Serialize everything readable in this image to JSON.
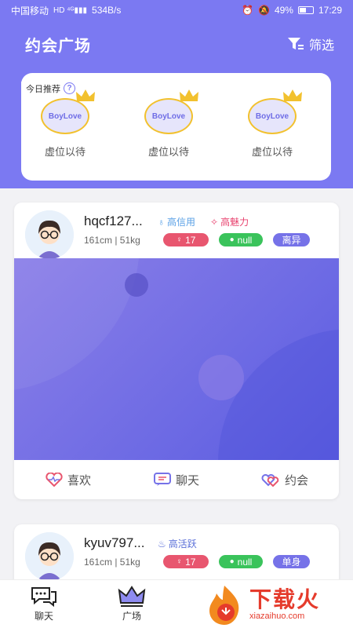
{
  "status_bar": {
    "carrier": "中国移动",
    "speed": "534B/s",
    "battery": "49%",
    "time": "17:29"
  },
  "header": {
    "title": "约会广场",
    "filter_label": "筛选"
  },
  "recommend": {
    "badge": "今日推荐",
    "items": [
      {
        "logo": "BoyLove",
        "label": "虚位以待"
      },
      {
        "logo": "BoyLove",
        "label": "虚位以待"
      },
      {
        "logo": "BoyLove",
        "label": "虚位以待"
      }
    ]
  },
  "profiles": [
    {
      "name": "hqcf127...",
      "tags": [
        {
          "icon": "bulb-icon",
          "label": "高信用",
          "color": "#5aa0e6"
        },
        {
          "icon": "sparkle-icon",
          "label": "高魅力",
          "color": "#e8436f"
        }
      ],
      "info": "161cm | 51kg",
      "age": "17",
      "location": "null",
      "status": "离异",
      "actions": {
        "like": "喜欢",
        "chat": "聊天",
        "date": "约会"
      }
    },
    {
      "name": "kyuv797...",
      "tags": [
        {
          "icon": "flame-icon",
          "label": "高活跃",
          "color": "#5a6fd8"
        }
      ],
      "info": "161cm | 51kg",
      "age": "17",
      "location": "null",
      "status": "单身"
    }
  ],
  "tabbar": {
    "chat": "聊天",
    "plaza": "广场"
  },
  "watermark": {
    "main": "下载火",
    "sub": "xiazaihuo.com"
  },
  "colors": {
    "primary": "#7b79f2",
    "pink": "#e8566f",
    "green": "#3ac35b",
    "purple_pill": "#7672e8"
  }
}
